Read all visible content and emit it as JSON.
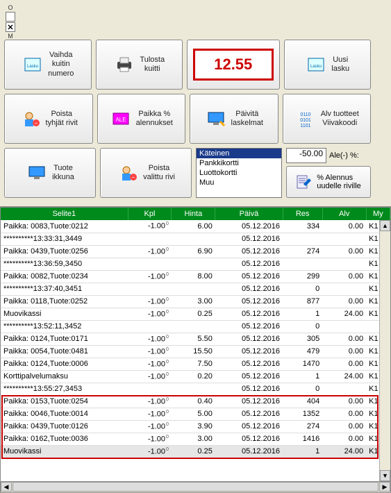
{
  "side": {
    "o": "O",
    "m": "M"
  },
  "toolbar": {
    "row1": [
      {
        "icon": "invoice",
        "label": "Vaihda\nkuitin\nnumero"
      },
      {
        "icon": "printer",
        "label": "Tulosta\nkuitti"
      },
      {
        "display": "12.55"
      },
      {
        "icon": "invoice",
        "label": "Uusi\nlasku"
      }
    ],
    "row2": [
      {
        "icon": "person-del",
        "label": "Poista\ntyhjät rivit"
      },
      {
        "icon": "sale",
        "label": "Paikka %\nalennukset"
      },
      {
        "icon": "monitor",
        "label": "Päivitä\nlaskelmat"
      },
      {
        "icon": "binary",
        "label": "Alv tuotteet\nViivakoodi"
      }
    ],
    "row3": [
      {
        "icon": "monitor",
        "label": "Tuote\nikkuna"
      },
      {
        "icon": "person-del",
        "label": "Poista\nvalittu rivi"
      }
    ],
    "payment_methods": [
      "Käteinen",
      "Pankkikortti",
      "Luottokortti",
      "Muu"
    ],
    "payment_selected": 0,
    "ale_value": "-50.00",
    "ale_label": "Ale(-) %:",
    "ale_button": "% Alennus\nuudelle riville"
  },
  "grid": {
    "columns": [
      "Selite1",
      "Kpl",
      "Hinta",
      "Päivä",
      "Res",
      "Alv",
      "My"
    ],
    "rows": [
      {
        "s": "Paikka: 0083,Tuote:0212",
        "k": "-1.00",
        "sup": "0",
        "h": "6.00",
        "p": "05.12.2016",
        "r": "334",
        "a": "0.00",
        "m": "K1"
      },
      {
        "s": "**********13:33:31,3449",
        "k": "",
        "sup": "",
        "h": "",
        "p": "05.12.2016",
        "r": "",
        "a": "",
        "m": "K1"
      },
      {
        "s": "Paikka: 0439,Tuote:0256",
        "k": "-1.00",
        "sup": "0",
        "h": "6.90",
        "p": "05.12.2016",
        "r": "274",
        "a": "0.00",
        "m": "K1"
      },
      {
        "s": "**********13:36:59,3450",
        "k": "",
        "sup": "",
        "h": "",
        "p": "05.12.2016",
        "r": "",
        "a": "",
        "m": "K1"
      },
      {
        "s": "Paikka: 0082,Tuote:0234",
        "k": "-1.00",
        "sup": "0",
        "h": "8.00",
        "p": "05.12.2016",
        "r": "299",
        "a": "0.00",
        "m": "K1"
      },
      {
        "s": "**********13:37:40,3451",
        "k": "",
        "sup": "",
        "h": "",
        "p": "05.12.2016",
        "r": "0",
        "a": "",
        "m": "K1"
      },
      {
        "s": "Paikka: 0118,Tuote:0252",
        "k": "-1.00",
        "sup": "0",
        "h": "3.00",
        "p": "05.12.2016",
        "r": "877",
        "a": "0.00",
        "m": "K1"
      },
      {
        "s": "Muovikassi",
        "k": "-1.00",
        "sup": "0",
        "h": "0.25",
        "p": "05.12.2016",
        "r": "1",
        "a": "24.00",
        "m": "K1"
      },
      {
        "s": "**********13:52:11,3452",
        "k": "",
        "sup": "",
        "h": "",
        "p": "05.12.2016",
        "r": "0",
        "a": "",
        "m": ""
      },
      {
        "s": "Paikka: 0124,Tuote:0171",
        "k": "-1.00",
        "sup": "0",
        "h": "5.50",
        "p": "05.12.2016",
        "r": "305",
        "a": "0.00",
        "m": "K1"
      },
      {
        "s": "Paikka: 0054,Tuote:0481",
        "k": "-1.00",
        "sup": "0",
        "h": "15.50",
        "p": "05.12.2016",
        "r": "479",
        "a": "0.00",
        "m": "K1"
      },
      {
        "s": "Paikka: 0124,Tuote:0006",
        "k": "-1.00",
        "sup": "0",
        "h": "7.50",
        "p": "05.12.2016",
        "r": "1470",
        "a": "0.00",
        "m": "K1"
      },
      {
        "s": "Korttipalvelumaksu",
        "k": "-1.00",
        "sup": "0",
        "h": "0.20",
        "p": "05.12.2016",
        "r": "1",
        "a": "24.00",
        "m": "K1"
      },
      {
        "s": "**********13:55:27,3453",
        "k": "",
        "sup": "",
        "h": "",
        "p": "05.12.2016",
        "r": "0",
        "a": "",
        "m": "K1"
      },
      {
        "s": "Paikka: 0153,Tuote:0254",
        "k": "-1.00",
        "sup": "0",
        "h": "0.40",
        "p": "05.12.2016",
        "r": "404",
        "a": "0.00",
        "m": "K1"
      },
      {
        "s": "Paikka: 0046,Tuote:0014",
        "k": "-1.00",
        "sup": "0",
        "h": "5.00",
        "p": "05.12.2016",
        "r": "1352",
        "a": "0.00",
        "m": "K1"
      },
      {
        "s": "Paikka: 0439,Tuote:0126",
        "k": "-1.00",
        "sup": "0",
        "h": "3.90",
        "p": "05.12.2016",
        "r": "274",
        "a": "0.00",
        "m": "K1"
      },
      {
        "s": "Paikka: 0162,Tuote:0036",
        "k": "-1.00",
        "sup": "0",
        "h": "3.00",
        "p": "05.12.2016",
        "r": "1416",
        "a": "0.00",
        "m": "K1"
      },
      {
        "s": "Muovikassi",
        "k": "-1.00",
        "sup": "0",
        "h": "0.25",
        "p": "05.12.2016",
        "r": "1",
        "a": "24.00",
        "m": "K1",
        "hl": true
      }
    ],
    "highlight_start": 14,
    "highlight_end": 18
  }
}
